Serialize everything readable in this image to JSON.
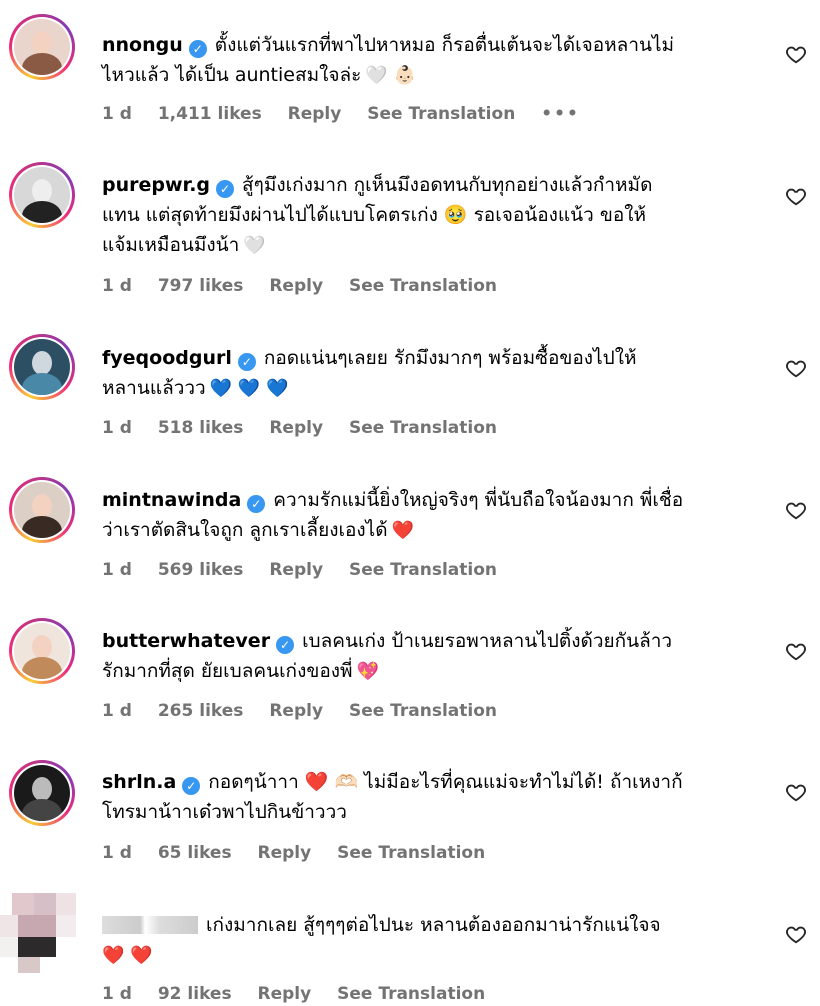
{
  "comments": [
    {
      "username": "nnongu",
      "verified": true,
      "line1": "ตั้งแต่วันแรกที่พาไปหาหมอ ก็รอตื่นเต้นจะได้เจอหลานไม่",
      "line2": "ไหวแล้ว ได้เป็น auntieสมใจล่ะ",
      "emojis": "🤍 👶🏻",
      "time": "1 d",
      "likes": "1,411 likes",
      "reply": "Reply",
      "translate": "See Translation",
      "more": "•••"
    },
    {
      "username": "purepwr.g",
      "verified": true,
      "line1": "สู้ๆมึงเก่งมาก กูเห็นมึงอดทนกับทุกอย่างแล้วกำหมัด",
      "line2": "แทน แต่สุดท้ายมึงผ่านไปได้แบบโคตรเก่ง 🥹 รอเจอน้องแน้ว ขอให้",
      "line3": "แจ้มเหมือนมึงน้า",
      "emojis": "🤍",
      "time": "1 d",
      "likes": "797 likes",
      "reply": "Reply",
      "translate": "See Translation"
    },
    {
      "username": "fyeqoodgurl",
      "verified": true,
      "line1": "กอดแน่นๆเลยย รักมึงมากๆ พร้อมซื้อของไปให้",
      "line2": "หลานแล้ววว",
      "emojis": "💙 💙 💙",
      "time": "1 d",
      "likes": "518 likes",
      "reply": "Reply",
      "translate": "See Translation"
    },
    {
      "username": "mintnawinda",
      "verified": true,
      "line1": "ความรักแม่นี้ยิ่งใหญ่จริงๆ พี่นับถือใจน้องมาก พี่เชื่อ",
      "line2": "ว่าเราตัดสินใจถูก ลูกเราเลี้ยงเองได้",
      "emojis": "❤️",
      "time": "1 d",
      "likes": "569 likes",
      "reply": "Reply",
      "translate": "See Translation"
    },
    {
      "username": "butterwhatever",
      "verified": true,
      "line1": "เบลคนเก่ง ป้าเนยรอพาหลานไปติ้งด้วยกันล้าว",
      "line2": "รักมากที่สุด ยัยเบลคนเก่งของพี่",
      "emojis": "💖",
      "time": "1 d",
      "likes": "265 likes",
      "reply": "Reply",
      "translate": "See Translation"
    },
    {
      "username": "shrln.a",
      "verified": true,
      "line1": "กอดๆน้าาา ❤️ 🫶🏻 ไม่มีอะไรที่คุณแม่จะทำไม่ได้! ถ้าเหงาก้",
      "line2": "โทรมาน้าาเด๋วพาไปกินข้าววว",
      "emojis": "",
      "time": "1 d",
      "likes": "65 likes",
      "reply": "Reply",
      "translate": "See Translation"
    },
    {
      "username": "",
      "verified": false,
      "line1": "เก่งมากเลย สู้ๆๆๆต่อไปนะ หลานต้องออกมาน่ารักแน่ใจจ",
      "line2": "",
      "emojis": "❤️ ❤️",
      "time": "1 d",
      "likes": "92 likes",
      "reply": "Reply",
      "translate": "See Translation"
    }
  ],
  "colors": {
    "verified": "#3897f0",
    "meta": "#737373",
    "heart": "#262626"
  },
  "icons": {
    "verified": "verified-badge-icon",
    "like": "heart-outline-icon"
  }
}
